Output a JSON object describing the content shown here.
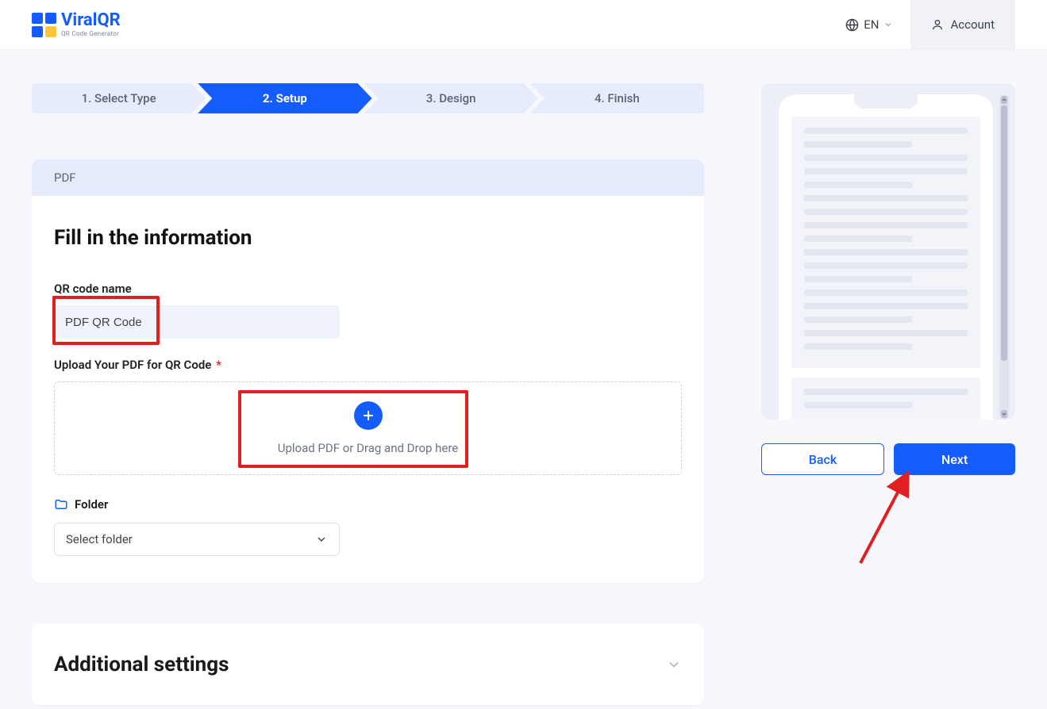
{
  "brand": {
    "name": "ViralQR",
    "subtitle": "QR Code Generator"
  },
  "header": {
    "language_label": "EN",
    "account_label": "Account"
  },
  "steps": [
    {
      "label": "1. Select Type",
      "active": false
    },
    {
      "label": "2. Setup",
      "active": true
    },
    {
      "label": "3. Design",
      "active": false
    },
    {
      "label": "4. Finish",
      "active": false
    }
  ],
  "form": {
    "card_title": "PDF",
    "heading": "Fill in the information",
    "name_label": "QR code name",
    "name_value": "PDF QR Code",
    "upload_label": "Upload Your PDF for QR Code",
    "upload_required_marker": "*",
    "upload_hint": "Upload PDF or Drag and Drop here",
    "folder_label": "Folder",
    "folder_placeholder": "Select folder"
  },
  "additional": {
    "title": "Additional settings"
  },
  "actions": {
    "back_label": "Back",
    "next_label": "Next"
  }
}
